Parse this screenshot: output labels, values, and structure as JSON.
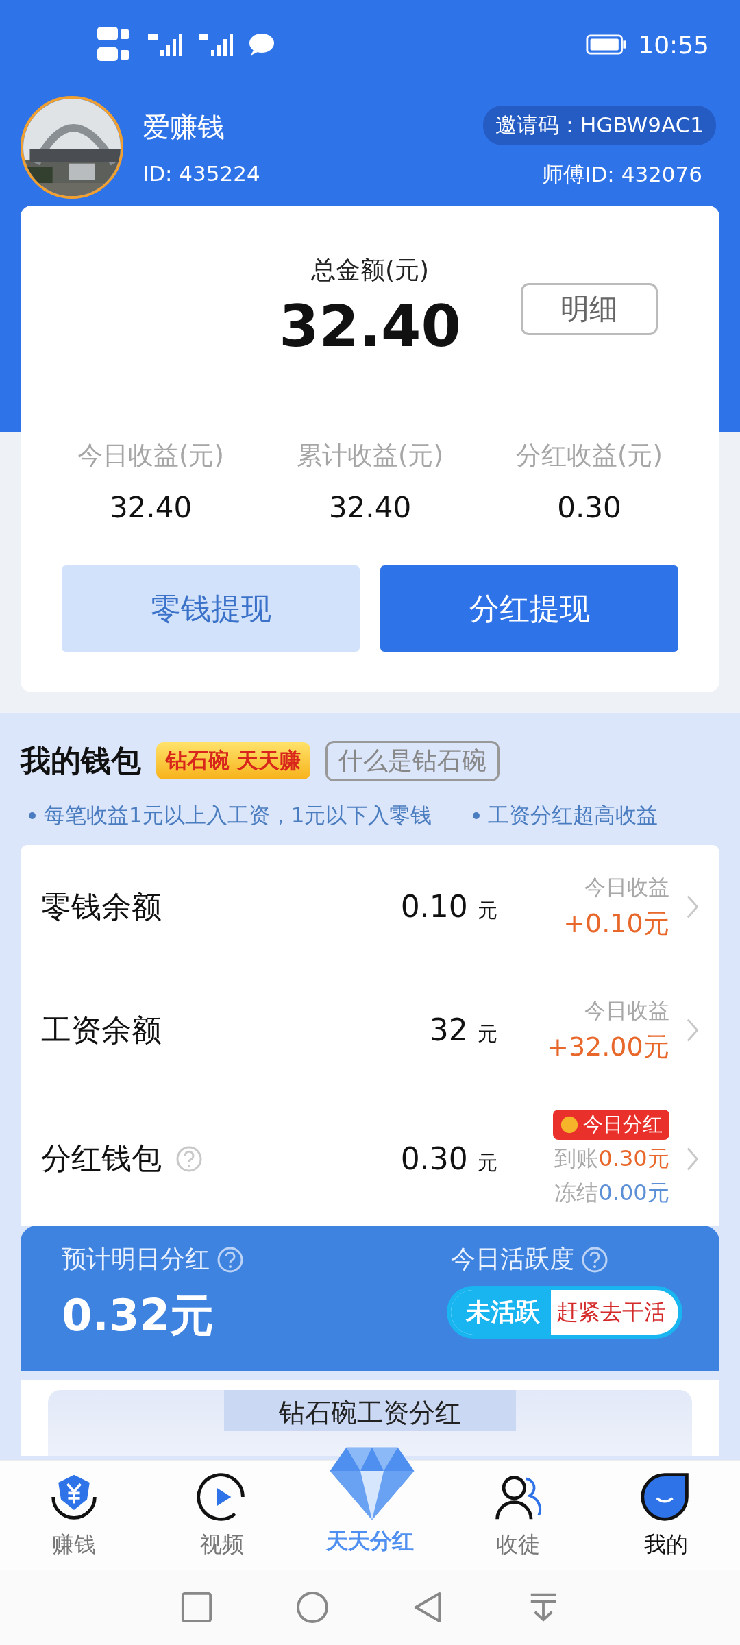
{
  "status_bar": {
    "time": "10:55"
  },
  "profile": {
    "name": "爱赚钱",
    "id": "ID: 435224",
    "invite_code": "邀请码：HGBW9AC1",
    "mentor_id": "师傅ID: 432076"
  },
  "summary": {
    "total_label": "总金额(元)",
    "total": "32.40",
    "detail_button": "明细",
    "stats": [
      {
        "label": "今日收益(元)",
        "value": "32.40"
      },
      {
        "label": "累计收益(元)",
        "value": "32.40"
      },
      {
        "label": "分红收益(元)",
        "value": "0.30"
      }
    ],
    "buttons": [
      {
        "label": "零钱提现",
        "kind": "light"
      },
      {
        "label": "分红提现",
        "kind": "primary"
      }
    ]
  },
  "wallet": {
    "title": "我的钱包",
    "badge": "钻石碗 天天赚",
    "link": "什么是钻石碗",
    "tips": [
      "每笔收益1元以上入工资，1元以下入零钱",
      "工资分红超高收益"
    ],
    "rows": [
      {
        "kind": "today",
        "name": "零钱余额",
        "amount": "0.10",
        "unit": "元",
        "today_label": "今日收益",
        "today_value": "+0.10元"
      },
      {
        "kind": "today",
        "name": "工资余额",
        "amount": "32",
        "unit": "元",
        "today_label": "今日收益",
        "today_value": "+32.00元"
      },
      {
        "kind": "dividend",
        "name": "分红钱包",
        "amount": "0.30",
        "unit": "元",
        "tag": "今日分红",
        "arrived_label": "到账",
        "arrived_value": "0.30元",
        "frozen_label": "冻结",
        "frozen_value": "0.00元"
      }
    ]
  },
  "forecast": {
    "label": "预计明日分红",
    "value": "0.32元",
    "activity_label": "今日活跃度",
    "status": "未活跃",
    "cta": "赶紧去干活"
  },
  "section_title": "钻石碗工资分红",
  "nav": {
    "center_label": "天天分红",
    "items": [
      {
        "label": "赚钱",
        "selected": false
      },
      {
        "label": "视频",
        "selected": false
      },
      {
        "label": "收徒",
        "selected": false
      },
      {
        "label": "我的",
        "selected": true
      }
    ]
  }
}
